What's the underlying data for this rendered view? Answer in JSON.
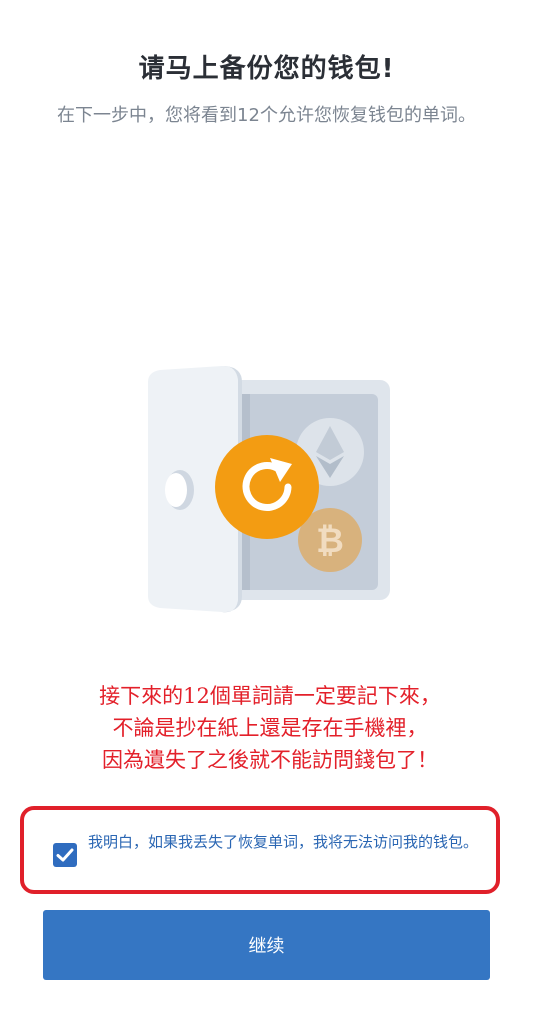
{
  "header": {
    "title": "请马上备份您的钱包!",
    "subtitle": "在下一步中，您将看到12个允许您恢复钱包的单词。"
  },
  "illustration": {
    "icons": [
      "vault-icon",
      "refresh-icon",
      "ethereum-icon",
      "bitcoin-icon"
    ],
    "colors": {
      "vault_light": "#e8edf3",
      "vault_mid": "#c9d2dd",
      "vault_dark": "#b4bfcd",
      "accent_orange": "#f39c12",
      "coin_bitcoin": "#dcb37d",
      "coin_ethereum": "#e3e8ee"
    }
  },
  "annotation": {
    "lines": [
      "接下來的12個單詞請一定要記下來，",
      "不論是抄在紙上還是存在手機裡，",
      "因為遺失了之後就不能訪問錢包了！"
    ],
    "color": "#e3202a"
  },
  "confirm": {
    "checked": true,
    "text": "我明白，如果我丢失了恢复单词，我将无法访问我的钱包。"
  },
  "continue_button": {
    "label": "继续",
    "color": "#3576c3"
  }
}
